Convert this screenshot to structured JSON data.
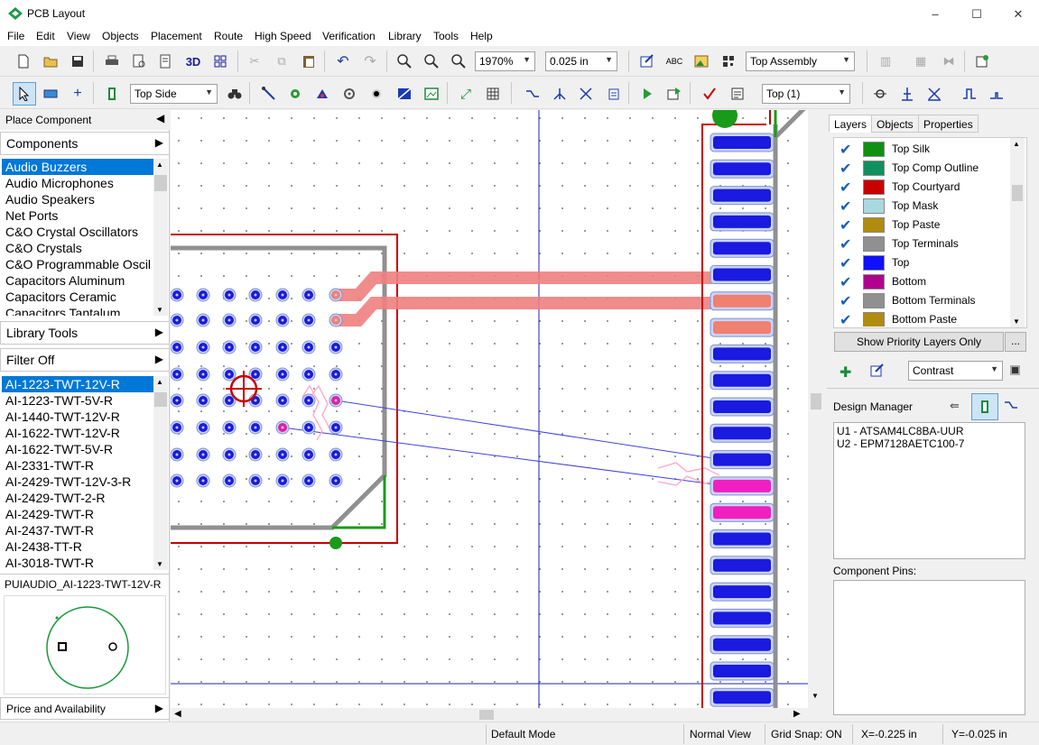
{
  "window": {
    "title": "PCB Layout",
    "controls": [
      "–",
      "☐",
      "✕"
    ]
  },
  "menu": [
    "File",
    "Edit",
    "View",
    "Objects",
    "Placement",
    "Route",
    "High Speed",
    "Verification",
    "Library",
    "Tools",
    "Help"
  ],
  "toolbar1": {
    "zoom": "1970%",
    "grid": "0.025 in",
    "view": "Top Assembly",
    "label_3d": "3D",
    "abc": "ABC"
  },
  "toolbar2": {
    "side": "Top Side",
    "layer": "Top (1)"
  },
  "left": {
    "place_component": "Place Component",
    "components_header": "Components",
    "categories": [
      "Audio Buzzers",
      "Audio Microphones",
      "Audio Speakers",
      "Net Ports",
      "C&O Crystal Oscillators",
      "C&O Crystals",
      "C&O Programmable Oscil",
      "Capacitors Aluminum",
      "Capacitors Ceramic",
      "Capacitors Tantalum"
    ],
    "library_tools": "Library Tools",
    "filter": "Filter Off",
    "parts": [
      "AI-1223-TWT-12V-R",
      "AI-1223-TWT-5V-R",
      "AI-1440-TWT-12V-R",
      "AI-1622-TWT-12V-R",
      "AI-1622-TWT-5V-R",
      "AI-2331-TWT-R",
      "AI-2429-TWT-12V-3-R",
      "AI-2429-TWT-2-R",
      "AI-2429-TWT-R",
      "AI-2437-TWT-R",
      "AI-2438-TT-R",
      "AI-3018-TWT-R"
    ],
    "preview_title": "PUIAUDIO_AI-1223-TWT-12V-R",
    "price": "Price and Availability"
  },
  "right": {
    "tabs": [
      "Layers",
      "Objects",
      "Properties"
    ],
    "layers": [
      {
        "name": "Top Silk",
        "color": "#109010"
      },
      {
        "name": "Top Comp Outline",
        "color": "#109060"
      },
      {
        "name": "Top Courtyard",
        "color": "#c80000"
      },
      {
        "name": "Top Mask",
        "color": "#a8d8e0"
      },
      {
        "name": "Top Paste",
        "color": "#b08c10"
      },
      {
        "name": "Top Terminals",
        "color": "#909090"
      },
      {
        "name": "Top",
        "color": "#1010ff"
      },
      {
        "name": "Bottom",
        "color": "#b00090"
      },
      {
        "name": "Bottom Terminals",
        "color": "#909090"
      },
      {
        "name": "Bottom Paste",
        "color": "#b08c10"
      }
    ],
    "priority_btn": "Show Priority Layers Only",
    "more_btn": "...",
    "contrast": "Contrast",
    "design_manager": "Design Manager",
    "dm_items": [
      "U1 - ATSAM4LC8BA-UUR",
      "U2 - EPM7128AETC100-7"
    ],
    "component_pins": "Component Pins:"
  },
  "status": {
    "mode": "Default Mode",
    "view": "Normal View",
    "grid_snap": "Grid Snap: ON",
    "x": "X=-0.225 in",
    "y": "Y=-0.025 in"
  }
}
